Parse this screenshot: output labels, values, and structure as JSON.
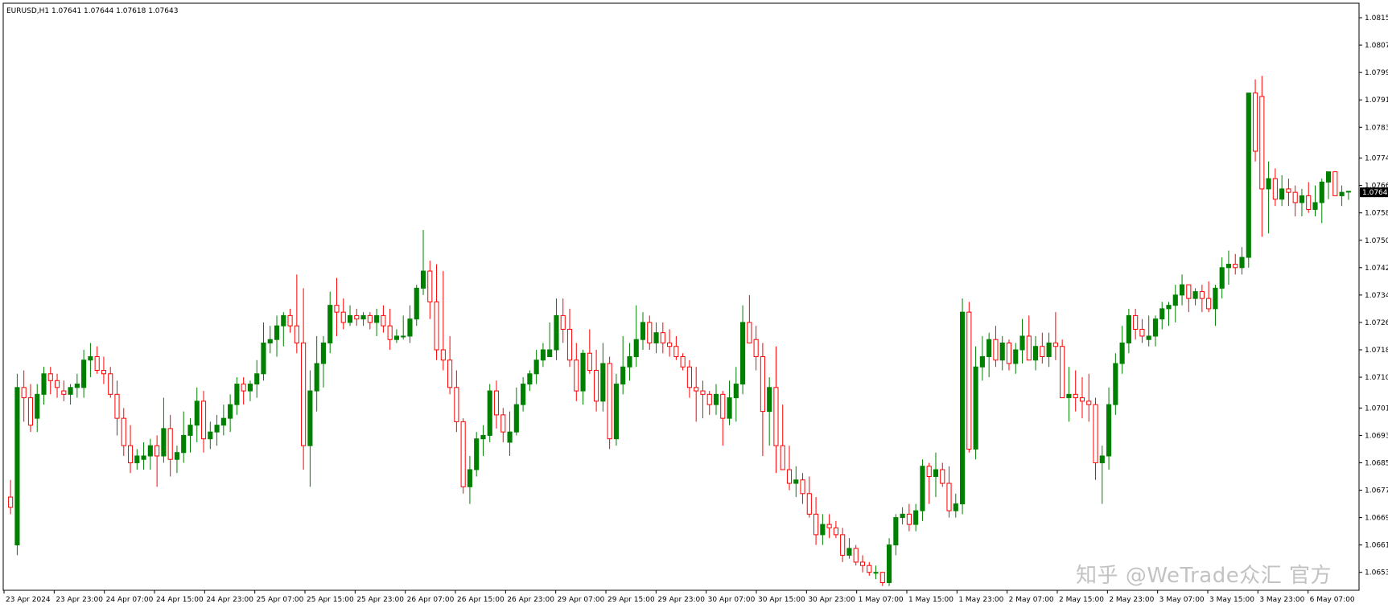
{
  "window": {
    "symbol_line": "EURUSD,H1  1.07641 1.07644 1.07618 1.07643",
    "watermark": "知乎 @WeTrade众汇 官方"
  },
  "colors": {
    "bull": "#008000",
    "bear": "#ff0000",
    "frame": "#000000",
    "background": "#ffffff",
    "current_price_bg": "#000000",
    "current_price_fg": "#ffffff"
  },
  "chart_data": {
    "type": "candlestick",
    "symbol": "EURUSD",
    "timeframe": "H1",
    "last_ohlc": [
      1.07641,
      1.07644,
      1.07618,
      1.07643
    ],
    "current_price_label": "1.0764",
    "ylim": [
      1.0648,
      1.0819
    ],
    "y_ticks": [
      "1.0815",
      "1.0807",
      "1.0799",
      "1.0791",
      "1.0783",
      "1.0774",
      "1.0766",
      "1.0758",
      "1.0750",
      "1.0742",
      "1.0734",
      "1.0726",
      "1.0718",
      "1.0710",
      "1.0701",
      "1.0693",
      "1.0685",
      "1.0677",
      "1.0669",
      "1.0661",
      "1.0653"
    ],
    "x_ticks": [
      "23 Apr 2024",
      "23 Apr 23:00",
      "24 Apr 07:00",
      "24 Apr 15:00",
      "24 Apr 23:00",
      "25 Apr 07:00",
      "25 Apr 15:00",
      "25 Apr 23:00",
      "26 Apr 07:00",
      "26 Apr 15:00",
      "26 Apr 23:00",
      "29 Apr 07:00",
      "29 Apr 15:00",
      "29 Apr 23:00",
      "30 Apr 07:00",
      "30 Apr 15:00",
      "30 Apr 23:00",
      "1 May 07:00",
      "1 May 15:00",
      "1 May 23:00",
      "2 May 07:00",
      "2 May 15:00",
      "2 May 23:00",
      "3 May 07:00",
      "3 May 15:00",
      "3 May 23:00",
      "6 May 07:00"
    ],
    "grid": false,
    "candles": [
      [
        1.0675,
        1.068,
        1.067,
        1.0672
      ],
      [
        1.0661,
        1.0711,
        1.0658,
        1.0707
      ],
      [
        1.0707,
        1.0712,
        1.0697,
        1.0704
      ],
      [
        1.0704,
        1.0708,
        1.0694,
        1.0696
      ],
      [
        1.0698,
        1.0708,
        1.0694,
        1.0705
      ],
      [
        1.0705,
        1.0713,
        1.0702,
        1.0711
      ],
      [
        1.0711,
        1.0713,
        1.0705,
        1.0709
      ],
      [
        1.0709,
        1.0711,
        1.0704,
        1.0707
      ],
      [
        1.0706,
        1.0709,
        1.0703,
        1.0705
      ],
      [
        1.0705,
        1.0708,
        1.0702,
        1.0707
      ],
      [
        1.0707,
        1.0711,
        1.0704,
        1.0708
      ],
      [
        1.0707,
        1.0718,
        1.0704,
        1.0715
      ],
      [
        1.0715,
        1.072,
        1.071,
        1.0716
      ],
      [
        1.0716,
        1.0719,
        1.0711,
        1.0712
      ],
      [
        1.0712,
        1.0716,
        1.0708,
        1.0711
      ],
      [
        1.0711,
        1.0713,
        1.0704,
        1.0705
      ],
      [
        1.0705,
        1.0709,
        1.0693,
        1.0698
      ],
      [
        1.0698,
        1.0701,
        1.0687,
        1.069
      ],
      [
        1.069,
        1.0696,
        1.0682,
        1.0685
      ],
      [
        1.0685,
        1.0689,
        1.0683,
        1.0687
      ],
      [
        1.0686,
        1.0691,
        1.0683,
        1.0687
      ],
      [
        1.0687,
        1.0692,
        1.0683,
        1.069
      ],
      [
        1.069,
        1.0693,
        1.0678,
        1.0687
      ],
      [
        1.0687,
        1.0704,
        1.0685,
        1.0695
      ],
      [
        1.0695,
        1.0699,
        1.0681,
        1.0686
      ],
      [
        1.0686,
        1.069,
        1.0682,
        1.0688
      ],
      [
        1.0688,
        1.07,
        1.0685,
        1.0693
      ],
      [
        1.0693,
        1.0698,
        1.0688,
        1.0696
      ],
      [
        1.0696,
        1.0707,
        1.0691,
        1.0703
      ],
      [
        1.0703,
        1.0706,
        1.0688,
        1.0692
      ],
      [
        1.0692,
        1.0697,
        1.0689,
        1.0694
      ],
      [
        1.0694,
        1.0699,
        1.069,
        1.0696
      ],
      [
        1.0696,
        1.0702,
        1.0693,
        1.0698
      ],
      [
        1.0698,
        1.0705,
        1.0694,
        1.0702
      ],
      [
        1.0702,
        1.071,
        1.0699,
        1.0708
      ],
      [
        1.0708,
        1.071,
        1.0702,
        1.0706
      ],
      [
        1.0706,
        1.0709,
        1.0703,
        1.0708
      ],
      [
        1.0708,
        1.0715,
        1.0704,
        1.0711
      ],
      [
        1.0711,
        1.0726,
        1.0709,
        1.072
      ],
      [
        1.072,
        1.0725,
        1.0717,
        1.0721
      ],
      [
        1.0721,
        1.0728,
        1.0716,
        1.0725
      ],
      [
        1.0725,
        1.0729,
        1.0719,
        1.0728
      ],
      [
        1.0728,
        1.073,
        1.0723,
        1.0725
      ],
      [
        1.0725,
        1.074,
        1.0717,
        1.072
      ],
      [
        1.072,
        1.0736,
        1.0683,
        1.069
      ],
      [
        1.069,
        1.0712,
        1.0678,
        1.0706
      ],
      [
        1.0706,
        1.0722,
        1.07,
        1.0714
      ],
      [
        1.0714,
        1.0722,
        1.0707,
        1.072
      ],
      [
        1.072,
        1.0735,
        1.0717,
        1.0731
      ],
      [
        1.0731,
        1.0739,
        1.0722,
        1.0729
      ],
      [
        1.0729,
        1.0733,
        1.0724,
        1.0726
      ],
      [
        1.0726,
        1.0731,
        1.0725,
        1.0728
      ],
      [
        1.0728,
        1.073,
        1.0725,
        1.0727
      ],
      [
        1.0727,
        1.0729,
        1.0725,
        1.0728
      ],
      [
        1.0728,
        1.0729,
        1.0724,
        1.0726
      ],
      [
        1.0726,
        1.073,
        1.0722,
        1.0728
      ],
      [
        1.0728,
        1.0731,
        1.0723,
        1.0725
      ],
      [
        1.0725,
        1.073,
        1.0718,
        1.0721
      ],
      [
        1.0721,
        1.0724,
        1.072,
        1.0722
      ],
      [
        1.0722,
        1.0728,
        1.0721,
        1.0722
      ],
      [
        1.0722,
        1.0731,
        1.072,
        1.0727
      ],
      [
        1.0727,
        1.0737,
        1.0725,
        1.0736
      ],
      [
        1.0736,
        1.0753,
        1.0734,
        1.0741
      ],
      [
        1.0741,
        1.0744,
        1.0727,
        1.0732
      ],
      [
        1.0732,
        1.0743,
        1.0715,
        1.0718
      ],
      [
        1.0718,
        1.0741,
        1.0712,
        1.0715
      ],
      [
        1.0715,
        1.0722,
        1.0705,
        1.0707
      ],
      [
        1.0707,
        1.0712,
        1.0694,
        1.0697
      ],
      [
        1.0697,
        1.0698,
        1.0676,
        1.0678
      ],
      [
        1.0678,
        1.0687,
        1.0673,
        1.0683
      ],
      [
        1.0683,
        1.0694,
        1.0681,
        1.0692
      ],
      [
        1.0692,
        1.0696,
        1.0687,
        1.0693
      ],
      [
        1.0693,
        1.0708,
        1.0691,
        1.0706
      ],
      [
        1.0706,
        1.0709,
        1.0695,
        1.0699
      ],
      [
        1.0699,
        1.0701,
        1.0691,
        1.0694
      ],
      [
        1.0691,
        1.07,
        1.0687,
        1.0694
      ],
      [
        1.0694,
        1.0707,
        1.0693,
        1.0702
      ],
      [
        1.0702,
        1.071,
        1.07,
        1.0708
      ],
      [
        1.0708,
        1.0712,
        1.0706,
        1.0711
      ],
      [
        1.0711,
        1.0718,
        1.0708,
        1.0715
      ],
      [
        1.0715,
        1.072,
        1.0713,
        1.0718
      ],
      [
        1.0716,
        1.0726,
        1.0716,
        1.0718
      ],
      [
        1.0718,
        1.0733,
        1.0715,
        1.0728
      ],
      [
        1.0728,
        1.0733,
        1.072,
        1.0724
      ],
      [
        1.0724,
        1.073,
        1.0713,
        1.0715
      ],
      [
        1.0715,
        1.072,
        1.0703,
        1.0706
      ],
      [
        1.0706,
        1.0718,
        1.0702,
        1.0717
      ],
      [
        1.0717,
        1.0724,
        1.0711,
        1.0712
      ],
      [
        1.0712,
        1.0718,
        1.07,
        1.0703
      ],
      [
        1.0703,
        1.072,
        1.07,
        1.0714
      ],
      [
        1.0714,
        1.0716,
        1.0689,
        1.0692
      ],
      [
        1.0692,
        1.0711,
        1.069,
        1.0708
      ],
      [
        1.0708,
        1.0722,
        1.0705,
        1.0713
      ],
      [
        1.0713,
        1.072,
        1.0709,
        1.0716
      ],
      [
        1.0716,
        1.0731,
        1.0713,
        1.0721
      ],
      [
        1.0721,
        1.0729,
        1.0718,
        1.0726
      ],
      [
        1.0726,
        1.0728,
        1.0718,
        1.072
      ],
      [
        1.072,
        1.0726,
        1.0717,
        1.0723
      ],
      [
        1.0723,
        1.0726,
        1.0717,
        1.072
      ],
      [
        1.072,
        1.0724,
        1.0716,
        1.0719
      ],
      [
        1.0719,
        1.0722,
        1.0715,
        1.0716
      ],
      [
        1.0716,
        1.0717,
        1.0712,
        1.0713
      ],
      [
        1.0713,
        1.0715,
        1.0704,
        1.0707
      ],
      [
        1.0707,
        1.0713,
        1.0697,
        1.0706
      ],
      [
        1.0706,
        1.0709,
        1.0698,
        1.0705
      ],
      [
        1.0705,
        1.0706,
        1.0699,
        1.0702
      ],
      [
        1.0702,
        1.0708,
        1.0699,
        1.0705
      ],
      [
        1.0705,
        1.0706,
        1.069,
        1.0698
      ],
      [
        1.0698,
        1.0709,
        1.0696,
        1.0704
      ],
      [
        1.0704,
        1.0713,
        1.0697,
        1.0708
      ],
      [
        1.0708,
        1.0731,
        1.0705,
        1.0726
      ],
      [
        1.0726,
        1.0734,
        1.0721,
        1.072
      ],
      [
        1.0721,
        1.0725,
        1.0712,
        1.0716
      ],
      [
        1.0716,
        1.072,
        1.0687,
        1.07
      ],
      [
        1.07,
        1.071,
        1.069,
        1.0707
      ],
      [
        1.0707,
        1.0719,
        1.0682,
        1.069
      ],
      [
        1.069,
        1.0702,
        1.0683,
        1.0683
      ],
      [
        1.0683,
        1.069,
        1.0677,
        1.0679
      ],
      [
        1.0679,
        1.0684,
        1.0675,
        1.068
      ],
      [
        1.068,
        1.0682,
        1.0673,
        1.0676
      ],
      [
        1.0676,
        1.0681,
        1.0669,
        1.067
      ],
      [
        1.067,
        1.0675,
        1.0661,
        1.0664
      ],
      [
        1.0664,
        1.067,
        1.0661,
        1.0667
      ],
      [
        1.0667,
        1.067,
        1.0663,
        1.0666
      ],
      [
        1.0666,
        1.0668,
        1.0663,
        1.0664
      ],
      [
        1.0664,
        1.0666,
        1.0656,
        1.0658
      ],
      [
        1.0658,
        1.0663,
        1.0657,
        1.066
      ],
      [
        1.066,
        1.0661,
        1.0655,
        1.0656
      ],
      [
        1.0656,
        1.0658,
        1.0653,
        1.0655
      ],
      [
        1.0655,
        1.0656,
        1.0652,
        1.0653
      ],
      [
        1.0653,
        1.0655,
        1.0651,
        1.0653
      ],
      [
        1.0653,
        1.0652,
        1.0649,
        1.065
      ],
      [
        1.065,
        1.0663,
        1.0649,
        1.0661
      ],
      [
        1.0661,
        1.067,
        1.0658,
        1.0669
      ],
      [
        1.0669,
        1.0672,
        1.0667,
        1.067
      ],
      [
        1.067,
        1.0673,
        1.0665,
        1.0667
      ],
      [
        1.0667,
        1.0673,
        1.0665,
        1.0671
      ],
      [
        1.0671,
        1.0686,
        1.0668,
        1.0684
      ],
      [
        1.0684,
        1.0685,
        1.0673,
        1.0681
      ],
      [
        1.0681,
        1.0688,
        1.0675,
        1.0683
      ],
      [
        1.0683,
        1.0685,
        1.0678,
        1.0679
      ],
      [
        1.0679,
        1.0684,
        1.0669,
        1.0671
      ],
      [
        1.0671,
        1.0676,
        1.0669,
        1.0673
      ],
      [
        1.0673,
        1.0733,
        1.067,
        1.0729
      ],
      [
        1.0729,
        1.0732,
        1.0688,
        1.0689
      ],
      [
        1.0689,
        1.0719,
        1.0686,
        1.0713
      ],
      [
        1.0713,
        1.0722,
        1.0709,
        1.0716
      ],
      [
        1.0716,
        1.0723,
        1.071,
        1.0721
      ],
      [
        1.0721,
        1.0725,
        1.0713,
        1.0715
      ],
      [
        1.0715,
        1.0722,
        1.0712,
        1.072
      ],
      [
        1.072,
        1.0721,
        1.0712,
        1.0714
      ],
      [
        1.0714,
        1.072,
        1.0711,
        1.0718
      ],
      [
        1.0718,
        1.0727,
        1.0714,
        1.0722
      ],
      [
        1.0722,
        1.0728,
        1.0716,
        1.0715
      ],
      [
        1.0715,
        1.0722,
        1.0712,
        1.0719
      ],
      [
        1.0719,
        1.0723,
        1.0714,
        1.0716
      ],
      [
        1.0716,
        1.0723,
        1.0713,
        1.072
      ],
      [
        1.072,
        1.0729,
        1.0715,
        1.0719
      ],
      [
        1.0719,
        1.0721,
        1.0709,
        1.0704
      ],
      [
        1.0704,
        1.0713,
        1.0697,
        1.0705
      ],
      [
        1.0705,
        1.0712,
        1.07,
        1.0704
      ],
      [
        1.0704,
        1.071,
        1.0698,
        1.0703
      ],
      [
        1.0703,
        1.0711,
        1.0697,
        1.0702
      ],
      [
        1.0702,
        1.0704,
        1.068,
        1.0685
      ],
      [
        1.0685,
        1.069,
        1.0673,
        1.0687
      ],
      [
        1.0687,
        1.0707,
        1.0683,
        1.0702
      ],
      [
        1.0702,
        1.0717,
        1.0699,
        1.0714
      ],
      [
        1.0714,
        1.0725,
        1.0711,
        1.072
      ],
      [
        1.072,
        1.073,
        1.0717,
        1.0728
      ],
      [
        1.0728,
        1.073,
        1.0721,
        1.0724
      ],
      [
        1.0724,
        1.0727,
        1.072,
        1.0722
      ],
      [
        1.0721,
        1.0728,
        1.0719,
        1.0722
      ],
      [
        1.0722,
        1.0728,
        1.0719,
        1.0727
      ],
      [
        1.0727,
        1.0732,
        1.0724,
        1.073
      ],
      [
        1.073,
        1.0732,
        1.0725,
        1.0731
      ],
      [
        1.0731,
        1.0737,
        1.0726,
        1.0734
      ],
      [
        1.0734,
        1.074,
        1.0731,
        1.0737
      ],
      [
        1.0737,
        1.0737,
        1.0729,
        1.0733
      ],
      [
        1.0733,
        1.0736,
        1.0731,
        1.0735
      ],
      [
        1.0735,
        1.0737,
        1.0729,
        1.0733
      ],
      [
        1.0733,
        1.0738,
        1.0729,
        1.073
      ],
      [
        1.073,
        1.0737,
        1.0725,
        1.0736
      ],
      [
        1.0736,
        1.0745,
        1.0733,
        1.0742
      ],
      [
        1.0742,
        1.0747,
        1.0737,
        1.0743
      ],
      [
        1.0743,
        1.0746,
        1.074,
        1.0742
      ],
      [
        1.0742,
        1.0748,
        1.074,
        1.0745
      ],
      [
        1.0745,
        1.0793,
        1.0742,
        1.0793
      ],
      [
        1.0793,
        1.0797,
        1.0773,
        1.0776
      ],
      [
        1.0792,
        1.0798,
        1.0751,
        1.0765
      ],
      [
        1.0765,
        1.0773,
        1.0752,
        1.0768
      ],
      [
        1.0768,
        1.0771,
        1.076,
        1.0762
      ],
      [
        1.0762,
        1.0769,
        1.076,
        1.0765
      ],
      [
        1.0765,
        1.0768,
        1.076,
        1.0764
      ],
      [
        1.0764,
        1.0766,
        1.0757,
        1.0761
      ],
      [
        1.0761,
        1.0765,
        1.0757,
        1.0763
      ],
      [
        1.0763,
        1.0767,
        1.0758,
        1.0759
      ],
      [
        1.0759,
        1.0766,
        1.0757,
        1.0761
      ],
      [
        1.0761,
        1.0768,
        1.0755,
        1.0767
      ],
      [
        1.0767,
        1.077,
        1.0762,
        1.077
      ],
      [
        1.077,
        1.077,
        1.0763,
        1.0763
      ],
      [
        1.0763,
        1.0766,
        1.076,
        1.0764
      ],
      [
        1.07641,
        1.07644,
        1.07618,
        1.07643
      ]
    ]
  }
}
